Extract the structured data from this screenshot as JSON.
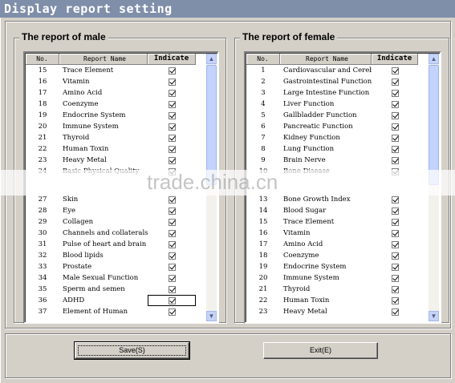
{
  "window": {
    "title": "Display report setting"
  },
  "columns": {
    "no": "No.",
    "name": "Report Name",
    "indicate": "Indicate"
  },
  "male": {
    "legend": "The report of male",
    "rows_top": [
      {
        "no": "15",
        "name": "Trace Element",
        "checked": true
      },
      {
        "no": "16",
        "name": "Vitamin",
        "checked": true
      },
      {
        "no": "17",
        "name": "Amino Acid",
        "checked": true
      },
      {
        "no": "18",
        "name": "Coenzyme",
        "checked": true
      },
      {
        "no": "19",
        "name": "Endocrine System",
        "checked": true
      },
      {
        "no": "20",
        "name": "Immune System",
        "checked": true
      },
      {
        "no": "21",
        "name": "Thyroid",
        "checked": true
      },
      {
        "no": "22",
        "name": "Human Toxin",
        "checked": true
      },
      {
        "no": "23",
        "name": "Heavy Metal",
        "checked": true
      },
      {
        "no": "24",
        "name": "Basic Physical Quality",
        "checked": true
      }
    ],
    "rows_bottom": [
      {
        "no": "27",
        "name": "Skin",
        "checked": true
      },
      {
        "no": "28",
        "name": "Eye",
        "checked": true
      },
      {
        "no": "29",
        "name": "Collagen",
        "checked": true
      },
      {
        "no": "30",
        "name": "Channels and collaterals",
        "checked": true
      },
      {
        "no": "31",
        "name": "Pulse of heart and brain",
        "checked": true
      },
      {
        "no": "32",
        "name": "Blood lipids",
        "checked": true
      },
      {
        "no": "33",
        "name": "Prostate",
        "checked": true
      },
      {
        "no": "34",
        "name": "Male Sexual Function",
        "checked": true
      },
      {
        "no": "35",
        "name": "Sperm and semen",
        "checked": true
      },
      {
        "no": "36",
        "name": "ADHD",
        "checked": true,
        "selected": true
      },
      {
        "no": "37",
        "name": "Element of Human",
        "checked": true
      }
    ]
  },
  "female": {
    "legend": "The report of female",
    "rows_top": [
      {
        "no": "1",
        "name": "Cardiovascular and Cerebrovascular",
        "checked": true
      },
      {
        "no": "2",
        "name": "Gastrointestinal Function",
        "checked": true
      },
      {
        "no": "3",
        "name": "Large Intestine Function",
        "checked": true
      },
      {
        "no": "4",
        "name": "Liver Function",
        "checked": true
      },
      {
        "no": "5",
        "name": "Gallbladder Function",
        "checked": true
      },
      {
        "no": "6",
        "name": "Pancreatic Function",
        "checked": true
      },
      {
        "no": "7",
        "name": "Kidney Function",
        "checked": true
      },
      {
        "no": "8",
        "name": "Lung Function",
        "checked": true
      },
      {
        "no": "9",
        "name": "Brain Nerve",
        "checked": true
      },
      {
        "no": "10",
        "name": "Bone Disease",
        "checked": true
      }
    ],
    "rows_bottom": [
      {
        "no": "13",
        "name": "Bone Growth Index",
        "checked": true
      },
      {
        "no": "14",
        "name": "Blood Sugar",
        "checked": true
      },
      {
        "no": "15",
        "name": "Trace Element",
        "checked": true
      },
      {
        "no": "16",
        "name": "Vitamin",
        "checked": true
      },
      {
        "no": "17",
        "name": "Amino Acid",
        "checked": true
      },
      {
        "no": "18",
        "name": "Coenzyme",
        "checked": true
      },
      {
        "no": "19",
        "name": "Endocrine System",
        "checked": true
      },
      {
        "no": "20",
        "name": "Immune System",
        "checked": true
      },
      {
        "no": "21",
        "name": "Thyroid",
        "checked": true
      },
      {
        "no": "22",
        "name": "Human Toxin",
        "checked": true
      },
      {
        "no": "23",
        "name": "Heavy Metal",
        "checked": true
      }
    ]
  },
  "buttons": {
    "save": "Save(S)",
    "exit": "Exit(E)"
  },
  "watermark": "trade.china.cn",
  "icons": {
    "scroll_up": "scroll-up-arrow-icon",
    "scroll_down": "scroll-down-arrow-icon",
    "checkbox": "checkbox-icon"
  }
}
